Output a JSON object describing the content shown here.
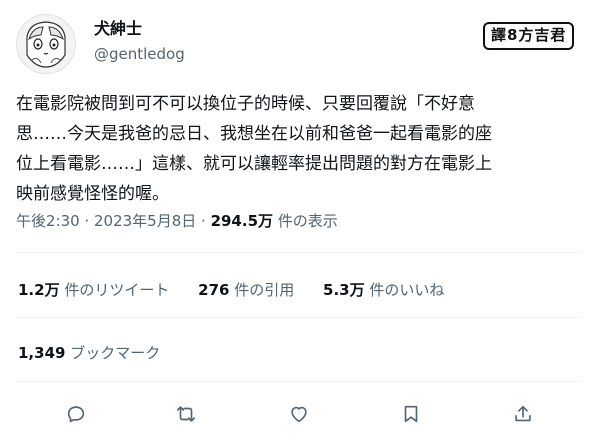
{
  "user": {
    "display_name": "犬紳士",
    "handle": "@gentledog"
  },
  "watermark": "譯8方吉君",
  "tweet": {
    "lines": [
      "在電影院被問到可不可以換位子的時候、只要回覆說「不好意",
      "思……今天是我爸的忌日、我想坐在以前和爸爸一起看電影的座",
      "位上看電影……」這樣、就可以讓輕率提出問題的對方在電影上",
      "映前感覺怪怪的喔。"
    ]
  },
  "meta": {
    "timestamp": "午後2:30 · 2023年5月8日 · ",
    "views_count": "294.5万",
    "views_label": " 件の表示"
  },
  "stats": {
    "retweets_count": "1.2万",
    "retweets_label": "件のリツイート",
    "quotes_count": "276",
    "quotes_label": "件の引用",
    "likes_count": "5.3万",
    "likes_label": "件のいいね",
    "bookmarks_count": "1,349",
    "bookmarks_label": "ブックマーク"
  },
  "actions": [
    "reply-icon",
    "retweet-icon",
    "like-icon",
    "bookmark-icon",
    "share-icon"
  ],
  "colors": {
    "text": "#0f1419",
    "secondary": "#536471",
    "divider": "#eff3f4"
  }
}
